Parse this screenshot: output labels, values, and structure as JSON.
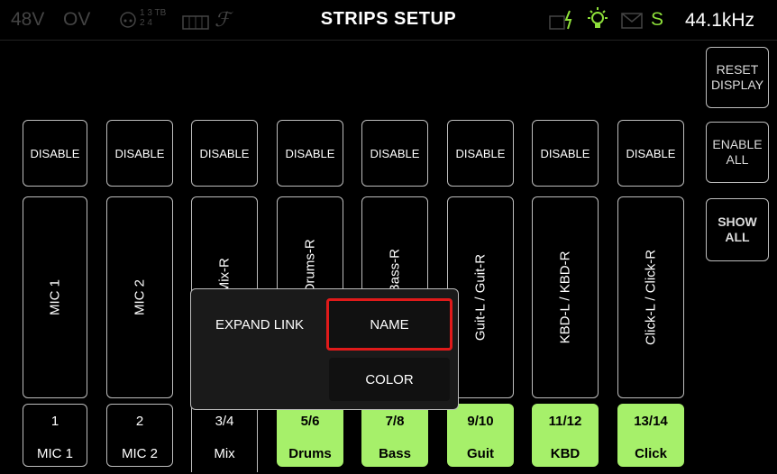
{
  "status": {
    "phantom": "48V",
    "overload": "OV",
    "routing_numbers": "1 3 TB\n2 4",
    "title": "STRIPS SETUP",
    "sample_rate": "44.1kHz",
    "s_indicator": "S",
    "colors": {
      "active": "#8ee03a",
      "inactive": "#444444"
    },
    "icons": [
      "input-routing-icon",
      "talkback-icon",
      "keyboard-icon",
      "fx-icon",
      "power-icon",
      "light-icon",
      "mail-icon"
    ]
  },
  "right_panel": {
    "reset_display": "RESET\nDISPLAY",
    "enable_all": "ENABLE\nALL",
    "show_all": "SHOW\nALL"
  },
  "disable_label": "DISABLE",
  "strips": [
    {
      "tall_name": "MIC 1",
      "num": "1",
      "name": "MIC 1",
      "active": false
    },
    {
      "tall_name": "MIC 2",
      "num": "2",
      "name": "MIC 2",
      "active": false
    },
    {
      "tall_name": "Mix-L / Mix-R",
      "num": "3/4",
      "name": "Mix",
      "active": false
    },
    {
      "tall_name": "Drums-L / Drums-R",
      "num": "5/6",
      "name": "Drums",
      "active": true
    },
    {
      "tall_name": "Bass-L / Bass-R",
      "num": "7/8",
      "name": "Bass",
      "active": true
    },
    {
      "tall_name": "Guit-L / Guit-R",
      "num": "9/10",
      "name": "Guit",
      "active": true
    },
    {
      "tall_name": "KBD-L / KBD-R",
      "num": "11/12",
      "name": "KBD",
      "active": true
    },
    {
      "tall_name": "Click-L / Click-R",
      "num": "13/14",
      "name": "Click",
      "active": true
    }
  ],
  "popup": {
    "expand_link": "EXPAND LINK",
    "name": "NAME",
    "color": "COLOR"
  }
}
